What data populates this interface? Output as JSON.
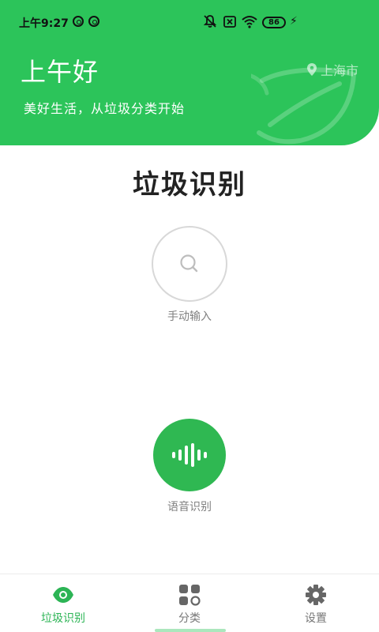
{
  "status_bar": {
    "time": "上午9:27",
    "battery": "86",
    "left_icons": [
      "vpn-ring-icon",
      "sync-ring-icon"
    ],
    "right_icons": [
      "mute-bell-icon",
      "sim-x-icon",
      "wifi-icon",
      "battery-icon",
      "charging-icon"
    ]
  },
  "header": {
    "greeting": "上午好",
    "slogan": "美好生活，从垃圾分类开始",
    "location": "上海市",
    "location_icon": "location-pin-icon",
    "background_color": "#2cc45a"
  },
  "main": {
    "title": "垃圾识别",
    "manual_input": {
      "label": "手动输入",
      "icon": "search-icon"
    },
    "voice_input": {
      "label": "语音识别",
      "icon": "voice-wave-icon",
      "color": "#2fb852"
    }
  },
  "tabbar": {
    "tabs": [
      {
        "label": "垃圾识别",
        "icon": "eye-icon",
        "active": true
      },
      {
        "label": "分类",
        "icon": "category-grid-icon",
        "active": false
      },
      {
        "label": "设置",
        "icon": "gear-icon",
        "active": false
      }
    ],
    "active_color": "#2cb455",
    "inactive_color": "#777777"
  }
}
